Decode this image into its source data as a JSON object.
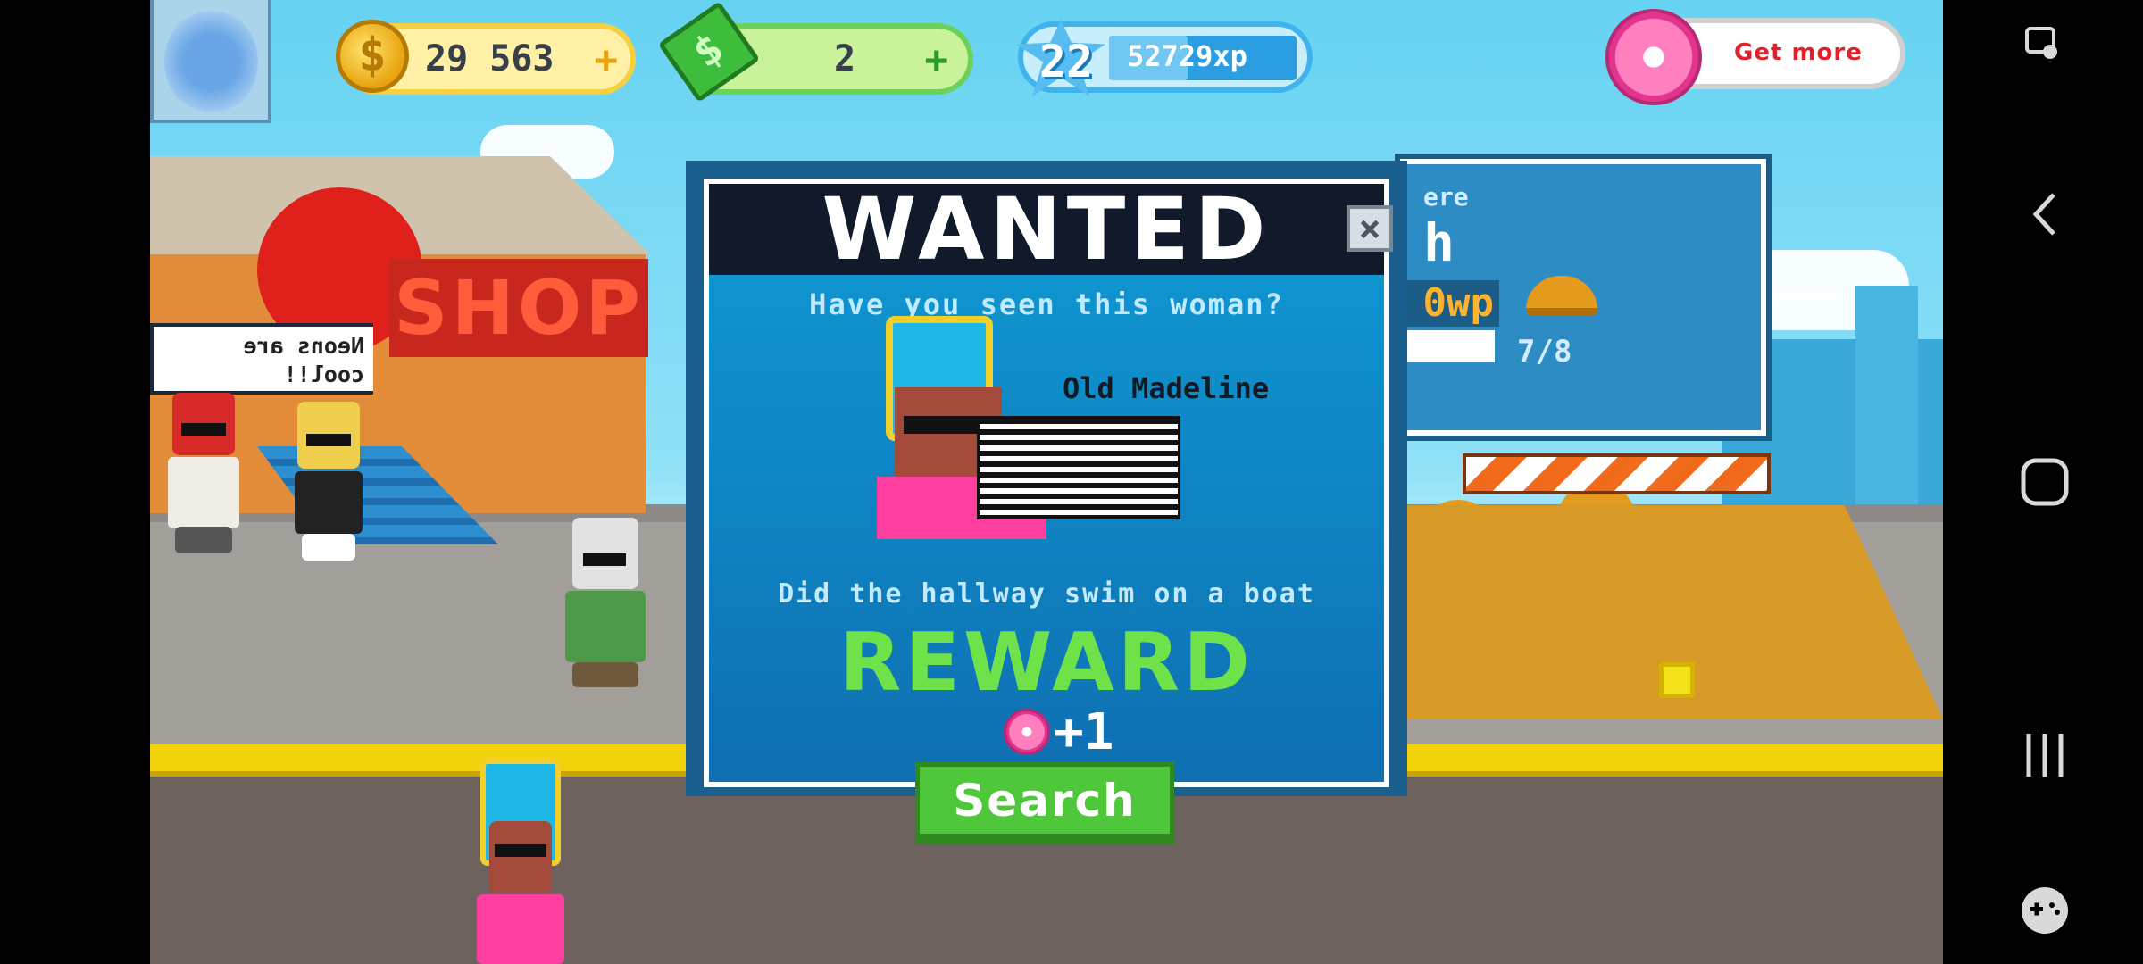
{
  "hud": {
    "coins": "29 563",
    "coins_plus": "+",
    "cash": "2",
    "cash_plus": "+",
    "level": "22",
    "xp": "52729xp",
    "xp_progress": 0.42,
    "get_more": "Get more"
  },
  "scene": {
    "shop_sign": "SHOP",
    "speech_bubble": "Neons are cool!!",
    "site_line1": "ere",
    "site_line2": "h",
    "site_wp": "0wp",
    "site_ratio": "7/8"
  },
  "modal": {
    "title": "WANTED",
    "close": "×",
    "question": "Have you seen this woman?",
    "suspect_name": "Old Madeline",
    "clue": "Did the hallway swim on a boat",
    "reward_label": "REWARD",
    "reward_amount": "+1",
    "search_button": "Search"
  },
  "icons": {
    "coin": "dollar-coin-icon",
    "cash": "banknote-icon",
    "xp": "star-level-icon",
    "donut": "donut-icon"
  },
  "colors": {
    "accent_green": "#4fc73a",
    "reward_green": "#6fe24a",
    "modal_blue": "#0f9bd4",
    "get_more_red": "#e0202a"
  }
}
